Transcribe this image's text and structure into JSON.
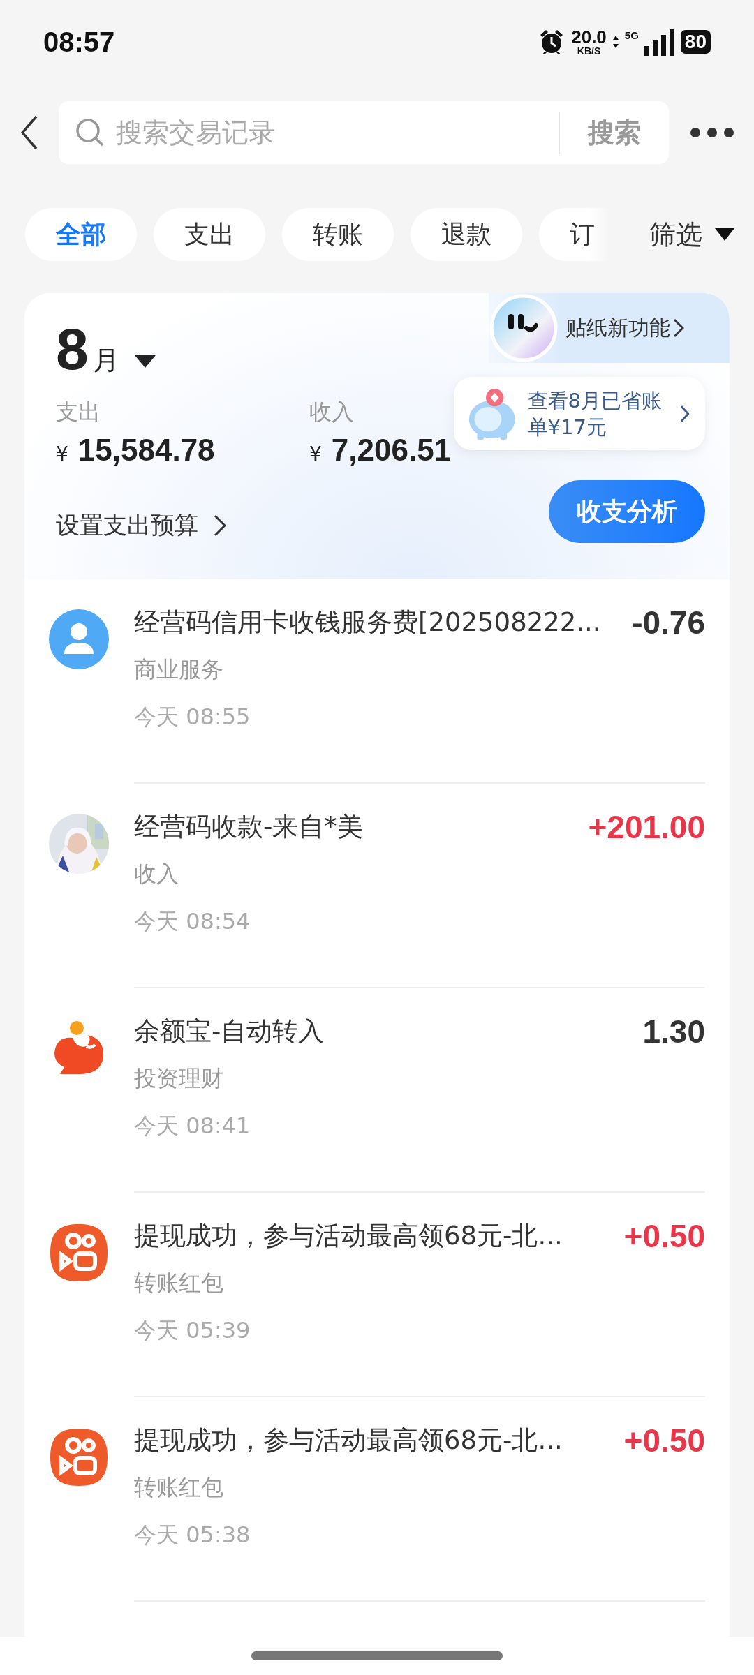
{
  "status_bar": {
    "time": "08:57",
    "net_speed": "20.0",
    "net_speed_unit": "KB/S",
    "network": "5G",
    "battery": "80"
  },
  "search": {
    "placeholder": "搜索交易记录",
    "button": "搜索"
  },
  "tabs": [
    {
      "label": "全部",
      "selected": true
    },
    {
      "label": "支出",
      "selected": false
    },
    {
      "label": "转账",
      "selected": false
    },
    {
      "label": "退款",
      "selected": false
    },
    {
      "label": "订",
      "selected": false
    }
  ],
  "filter": "筛选",
  "summary": {
    "month": "8",
    "month_unit": "月",
    "sticker_banner": "贴纸新功能",
    "savings_tip": "查看8月已省账单¥17元",
    "expense": {
      "label": "支出",
      "currency": "¥",
      "amount": "15,584.78"
    },
    "income": {
      "label": "收入",
      "currency": "¥",
      "amount": "7,206.51"
    },
    "budget_link": "设置支出预算",
    "analysis_button": "收支分析"
  },
  "transactions": [
    {
      "kind": "user",
      "title": "经营码信用卡收钱服务费[202508222...",
      "category": "商业服务",
      "time": "今天 08:55",
      "amount": "-0.76",
      "color": "#333333"
    },
    {
      "kind": "picture",
      "title": "经营码收款-来自*美",
      "category": "收入",
      "time": "今天 08:54",
      "amount": "+201.00",
      "color": "#e8374a"
    },
    {
      "kind": "fish",
      "title": "余额宝-自动转入",
      "category": "投资理财",
      "time": "今天 08:41",
      "amount": "1.30",
      "color": "#333333"
    },
    {
      "kind": "camera",
      "title": "提现成功，参与活动最高领68元-北...",
      "category": "转账红包",
      "time": "今天 05:39",
      "amount": "+0.50",
      "color": "#e8374a"
    },
    {
      "kind": "camera",
      "title": "提现成功，参与活动最高领68元-北...",
      "category": "转账红包",
      "time": "今天 05:38",
      "amount": "+0.50",
      "color": "#e8374a"
    }
  ]
}
